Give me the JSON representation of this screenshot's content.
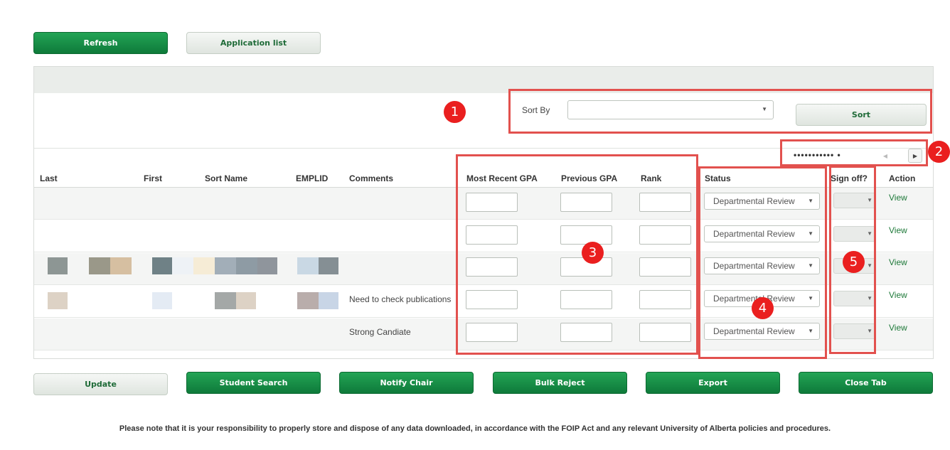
{
  "toolbar": {
    "refresh_label": "Refresh",
    "application_list_label": "Application list"
  },
  "sort": {
    "label": "Sort By",
    "selected_value": "",
    "button_label": "Sort"
  },
  "pager": {
    "dots": "•••••••••••  •",
    "prev_icon": "◀",
    "next_icon": "▶"
  },
  "table": {
    "columns": [
      "Last",
      "First",
      "Sort Name",
      "EMPLID",
      "Comments",
      "Most Recent GPA",
      "Previous GPA",
      "Rank",
      "Status",
      "Sign off?",
      "Action"
    ],
    "rows": [
      {
        "comment": "",
        "status": "Departmental Review",
        "action": "View"
      },
      {
        "comment": "",
        "status": "Departmental Review",
        "action": "View"
      },
      {
        "comment": "",
        "status": "Departmental Review",
        "action": "View"
      },
      {
        "comment": "Need to check publications",
        "status": "Departmental Review",
        "action": "View"
      },
      {
        "comment": "Strong Candiate",
        "status": "Departmental Review",
        "action": "View"
      }
    ]
  },
  "actions": {
    "update_label": "Update",
    "student_search_label": "Student Search",
    "notify_chair_label": "Notify Chair",
    "bulk_reject_label": "Bulk Reject",
    "export_label": "Export",
    "close_tab_label": "Close Tab"
  },
  "callouts": [
    "1",
    "2",
    "3",
    "4",
    "5"
  ],
  "footer": {
    "note": "Please note that it is your responsibility to properly store and dispose of any data downloaded, in accordance with the FOIP Act and any relevant University of Alberta policies and procedures."
  },
  "colors": {
    "primary_green": "#0e7a3a",
    "callout_red": "#e2514e",
    "badge_red": "#ea1f1f",
    "link_green": "#1f7a3a"
  }
}
